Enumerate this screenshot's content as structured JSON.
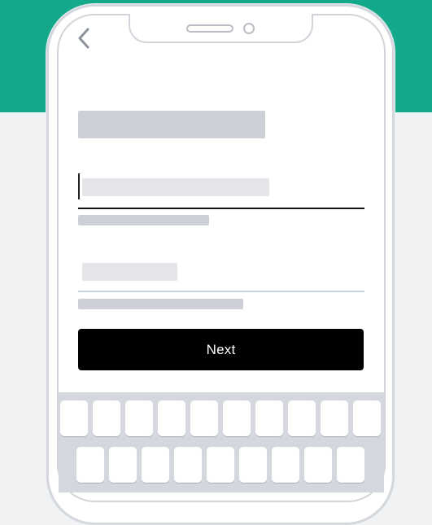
{
  "app": {
    "next_label": "Next"
  },
  "icons": {
    "back": "chevron-left-icon"
  },
  "colors": {
    "header_green": "#14a98a",
    "button_black": "#000000",
    "keyboard_gray": "#d4d8de"
  }
}
